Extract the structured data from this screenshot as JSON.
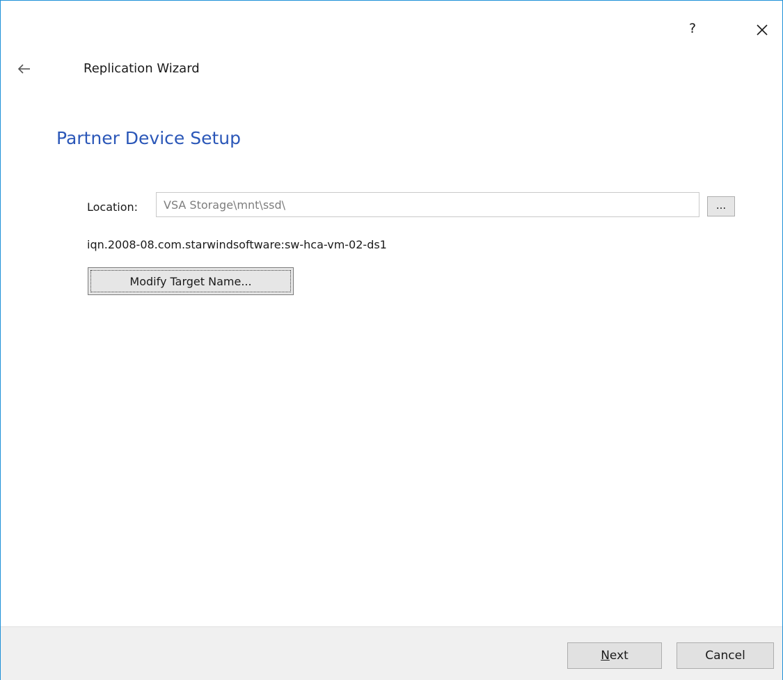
{
  "window": {
    "help_label": "?",
    "close_icon": "close-icon",
    "back_icon": "back-arrow-icon"
  },
  "header": {
    "wizard_title": "Replication Wizard"
  },
  "main": {
    "heading": "Partner Device Setup",
    "location": {
      "label": "Location:",
      "value": "VSA Storage\\mnt\\ssd\\",
      "browse_label": "..."
    },
    "target_name": "iqn.2008-08.com.starwindsoftware:sw-hca-vm-02-ds1",
    "modify_target_label": "Modify Target Name..."
  },
  "footer": {
    "next_mnemonic": "N",
    "next_rest": "ext",
    "cancel_label": "Cancel"
  },
  "colors": {
    "accent": "#2b57b8",
    "window_border": "#1e90d8",
    "footer_bg": "#f0f0f0"
  }
}
